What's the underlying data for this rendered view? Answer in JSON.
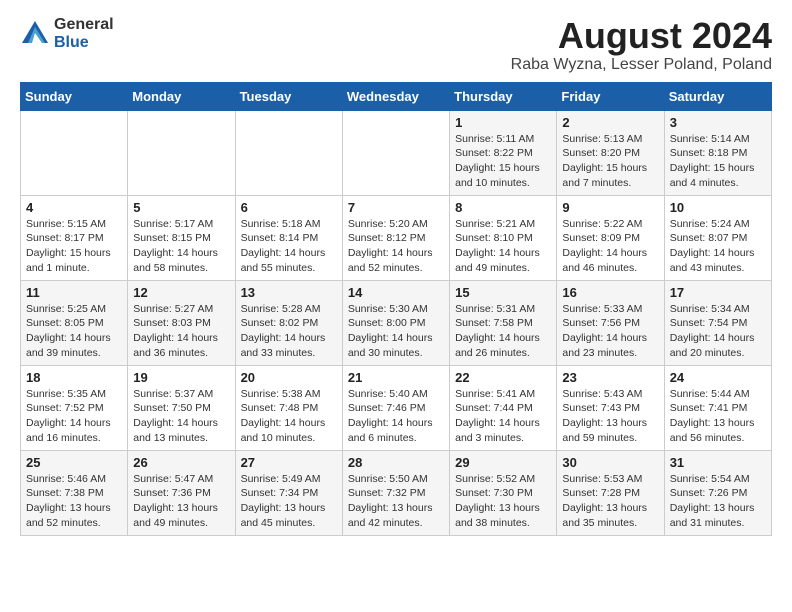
{
  "logo": {
    "general": "General",
    "blue": "Blue"
  },
  "title": "August 2024",
  "subtitle": "Raba Wyzna, Lesser Poland, Poland",
  "weekdays": [
    "Sunday",
    "Monday",
    "Tuesday",
    "Wednesday",
    "Thursday",
    "Friday",
    "Saturday"
  ],
  "weeks": [
    [
      {
        "day": "",
        "info": ""
      },
      {
        "day": "",
        "info": ""
      },
      {
        "day": "",
        "info": ""
      },
      {
        "day": "",
        "info": ""
      },
      {
        "day": "1",
        "info": "Sunrise: 5:11 AM\nSunset: 8:22 PM\nDaylight: 15 hours\nand 10 minutes."
      },
      {
        "day": "2",
        "info": "Sunrise: 5:13 AM\nSunset: 8:20 PM\nDaylight: 15 hours\nand 7 minutes."
      },
      {
        "day": "3",
        "info": "Sunrise: 5:14 AM\nSunset: 8:18 PM\nDaylight: 15 hours\nand 4 minutes."
      }
    ],
    [
      {
        "day": "4",
        "info": "Sunrise: 5:15 AM\nSunset: 8:17 PM\nDaylight: 15 hours\nand 1 minute."
      },
      {
        "day": "5",
        "info": "Sunrise: 5:17 AM\nSunset: 8:15 PM\nDaylight: 14 hours\nand 58 minutes."
      },
      {
        "day": "6",
        "info": "Sunrise: 5:18 AM\nSunset: 8:14 PM\nDaylight: 14 hours\nand 55 minutes."
      },
      {
        "day": "7",
        "info": "Sunrise: 5:20 AM\nSunset: 8:12 PM\nDaylight: 14 hours\nand 52 minutes."
      },
      {
        "day": "8",
        "info": "Sunrise: 5:21 AM\nSunset: 8:10 PM\nDaylight: 14 hours\nand 49 minutes."
      },
      {
        "day": "9",
        "info": "Sunrise: 5:22 AM\nSunset: 8:09 PM\nDaylight: 14 hours\nand 46 minutes."
      },
      {
        "day": "10",
        "info": "Sunrise: 5:24 AM\nSunset: 8:07 PM\nDaylight: 14 hours\nand 43 minutes."
      }
    ],
    [
      {
        "day": "11",
        "info": "Sunrise: 5:25 AM\nSunset: 8:05 PM\nDaylight: 14 hours\nand 39 minutes."
      },
      {
        "day": "12",
        "info": "Sunrise: 5:27 AM\nSunset: 8:03 PM\nDaylight: 14 hours\nand 36 minutes."
      },
      {
        "day": "13",
        "info": "Sunrise: 5:28 AM\nSunset: 8:02 PM\nDaylight: 14 hours\nand 33 minutes."
      },
      {
        "day": "14",
        "info": "Sunrise: 5:30 AM\nSunset: 8:00 PM\nDaylight: 14 hours\nand 30 minutes."
      },
      {
        "day": "15",
        "info": "Sunrise: 5:31 AM\nSunset: 7:58 PM\nDaylight: 14 hours\nand 26 minutes."
      },
      {
        "day": "16",
        "info": "Sunrise: 5:33 AM\nSunset: 7:56 PM\nDaylight: 14 hours\nand 23 minutes."
      },
      {
        "day": "17",
        "info": "Sunrise: 5:34 AM\nSunset: 7:54 PM\nDaylight: 14 hours\nand 20 minutes."
      }
    ],
    [
      {
        "day": "18",
        "info": "Sunrise: 5:35 AM\nSunset: 7:52 PM\nDaylight: 14 hours\nand 16 minutes."
      },
      {
        "day": "19",
        "info": "Sunrise: 5:37 AM\nSunset: 7:50 PM\nDaylight: 14 hours\nand 13 minutes."
      },
      {
        "day": "20",
        "info": "Sunrise: 5:38 AM\nSunset: 7:48 PM\nDaylight: 14 hours\nand 10 minutes."
      },
      {
        "day": "21",
        "info": "Sunrise: 5:40 AM\nSunset: 7:46 PM\nDaylight: 14 hours\nand 6 minutes."
      },
      {
        "day": "22",
        "info": "Sunrise: 5:41 AM\nSunset: 7:44 PM\nDaylight: 14 hours\nand 3 minutes."
      },
      {
        "day": "23",
        "info": "Sunrise: 5:43 AM\nSunset: 7:43 PM\nDaylight: 13 hours\nand 59 minutes."
      },
      {
        "day": "24",
        "info": "Sunrise: 5:44 AM\nSunset: 7:41 PM\nDaylight: 13 hours\nand 56 minutes."
      }
    ],
    [
      {
        "day": "25",
        "info": "Sunrise: 5:46 AM\nSunset: 7:38 PM\nDaylight: 13 hours\nand 52 minutes."
      },
      {
        "day": "26",
        "info": "Sunrise: 5:47 AM\nSunset: 7:36 PM\nDaylight: 13 hours\nand 49 minutes."
      },
      {
        "day": "27",
        "info": "Sunrise: 5:49 AM\nSunset: 7:34 PM\nDaylight: 13 hours\nand 45 minutes."
      },
      {
        "day": "28",
        "info": "Sunrise: 5:50 AM\nSunset: 7:32 PM\nDaylight: 13 hours\nand 42 minutes."
      },
      {
        "day": "29",
        "info": "Sunrise: 5:52 AM\nSunset: 7:30 PM\nDaylight: 13 hours\nand 38 minutes."
      },
      {
        "day": "30",
        "info": "Sunrise: 5:53 AM\nSunset: 7:28 PM\nDaylight: 13 hours\nand 35 minutes."
      },
      {
        "day": "31",
        "info": "Sunrise: 5:54 AM\nSunset: 7:26 PM\nDaylight: 13 hours\nand 31 minutes."
      }
    ]
  ]
}
